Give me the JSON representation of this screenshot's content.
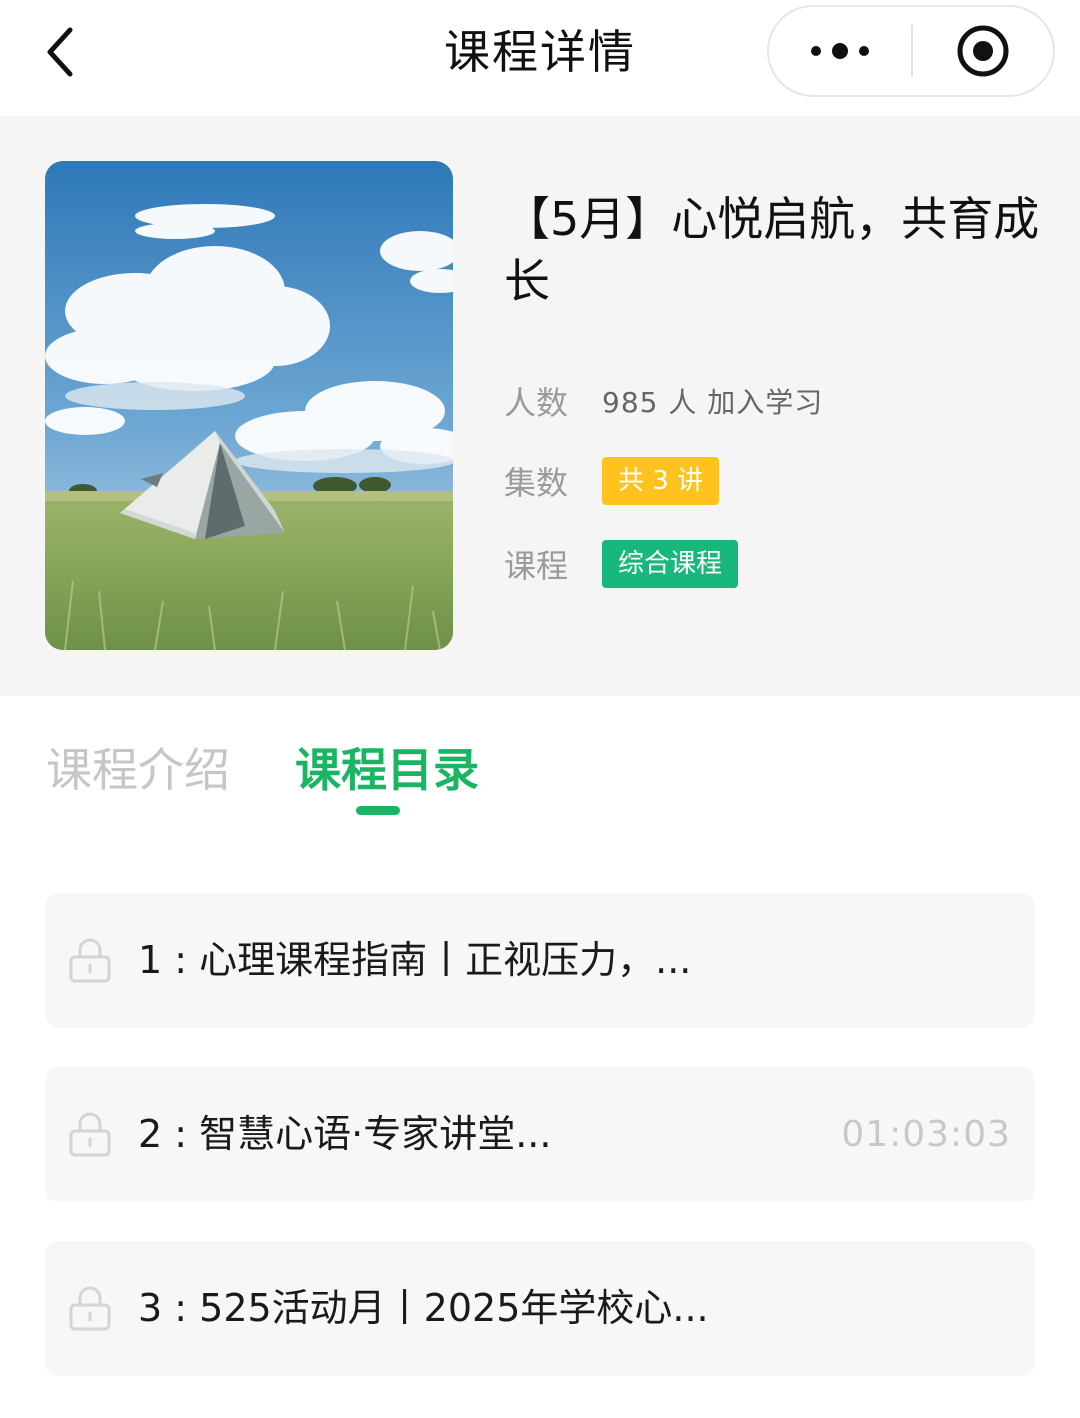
{
  "nav": {
    "title": "课程详情"
  },
  "course": {
    "title": "【5月】心悦启航，共育成长",
    "meta": {
      "people_label": "人数",
      "people_value": "985 人 加入学习",
      "episodes_label": "集数",
      "episodes_tag": "共 3 讲",
      "course_label": "课程",
      "course_tag": "综合课程"
    }
  },
  "tabs": [
    {
      "label": "课程介绍",
      "active": false
    },
    {
      "label": "课程目录",
      "active": true
    }
  ],
  "lessons": [
    {
      "title": "1 : 心理课程指南丨正视压力，...",
      "duration": "",
      "locked": true
    },
    {
      "title": "2 : 智慧心语·专家讲堂...",
      "duration": "01:03:03",
      "locked": true
    },
    {
      "title": "3 : 525活动月丨2025年学校心...",
      "duration": "",
      "locked": true
    }
  ],
  "colors": {
    "accent_green": "#19b562",
    "tag_orange": "#ffc21f",
    "tag_green": "#18b77b",
    "panel_bg": "#f5f5f5"
  },
  "icons": {
    "back": "chevron-left-icon",
    "more": "more-dots-icon",
    "close": "target-circle-icon",
    "lock": "lock-icon"
  }
}
